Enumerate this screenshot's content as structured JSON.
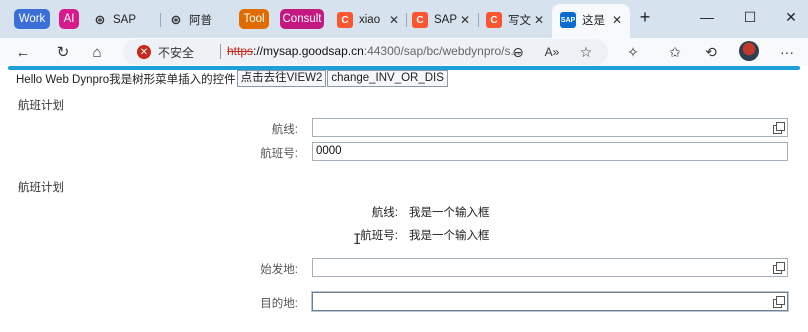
{
  "tabs": [
    {
      "label": "Work",
      "kind": "group",
      "color": "#3b6fd6"
    },
    {
      "label": "AI",
      "kind": "group",
      "color": "#d81b8a"
    },
    {
      "label": "SAP",
      "kind": "tab",
      "icon": "chatgpt-icon"
    },
    {
      "label": "阿普",
      "kind": "tab",
      "icon": "chatgpt-icon"
    },
    {
      "label": "Tool",
      "kind": "group",
      "color": "#e06c00"
    },
    {
      "label": "Consult",
      "kind": "group",
      "color": "#c2187f"
    },
    {
      "label": "xiao",
      "kind": "tab",
      "icon": "csdn-icon"
    },
    {
      "label": "SAP",
      "kind": "tab",
      "icon": "csdn-icon"
    },
    {
      "label": "写文",
      "kind": "tab",
      "icon": "csdn-icon"
    },
    {
      "label": "这是",
      "kind": "tab",
      "icon": "sap-icon",
      "active": true
    }
  ],
  "address": {
    "security": "不安全",
    "url_scheme": "https",
    "url_host": "://mysap.goodsap.cn",
    "url_path": ":44300/sap/bc/webdynpro/s..."
  },
  "page": {
    "hello_text": "Hello Web Dynpro我是树形菜单插入的控件",
    "btn_view2": "点击去往VIEW2",
    "btn_change": "change_INV_OR_DIS",
    "section1_title": "航班计划",
    "route_label": "航线:",
    "route_value": "",
    "flight_label": "航班号:",
    "flight_value": "0000",
    "section2_title": "航班计划",
    "route2_label": "航线:",
    "route2_value": "我是一个输入框",
    "flight2_label": "航班号:",
    "flight2_value": "我是一个输入框",
    "origin_label": "始发地:",
    "origin_value": "",
    "dest_label": "目的地:",
    "dest_value": ""
  },
  "colors": {
    "accent": "#1d9fd8",
    "tabstrip": "#d6e2ee",
    "warning": "#c42b1c"
  }
}
